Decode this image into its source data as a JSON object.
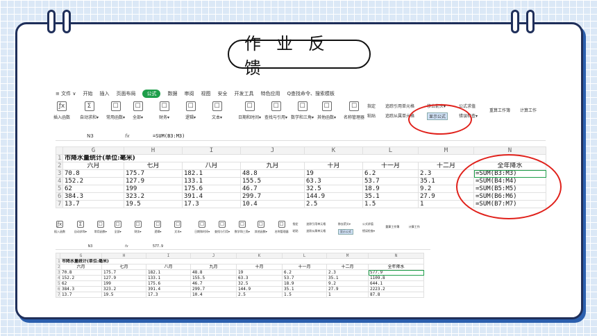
{
  "slide": {
    "title": "作业反馈"
  },
  "menubar": {
    "items": [
      "≡ 文件 ∨",
      "开始",
      "插入",
      "页面布局",
      "公式",
      "数据",
      "审阅",
      "视图",
      "安全",
      "开发工具",
      "特色应用",
      "Q查找命令、搜索模板"
    ],
    "active_index": 4
  },
  "ribbon": {
    "buttons": [
      "插入函数",
      "自动求和▾",
      "常用函数▾",
      "全部▾",
      "财务▾",
      "逻辑▾",
      "文本▾",
      "日期和时间▾",
      "查找与引用▾",
      "数学和三角▾",
      "其他函数▾",
      "名称管理器"
    ],
    "small_items": [
      "指定",
      "粘贴",
      "追踪引用单元格",
      "追踪从属单元格",
      "移去箭头▾",
      "显示公式",
      "公式求值",
      "错误检查▾",
      "重算工作簿",
      "计算工作"
    ]
  },
  "formula_bar": {
    "cell_ref": "N3",
    "fx": "fx",
    "formula": "=SUM(B3:M3)"
  },
  "sheet": {
    "col_headers": [
      "",
      "G",
      "H",
      "I",
      "J",
      "K",
      "L",
      "M",
      "N"
    ],
    "title": "市降水量统计(单位:毫米)",
    "months": [
      "六月",
      "七月",
      "八月",
      "九月",
      "十月",
      "十一月",
      "十二月",
      "全年降水"
    ],
    "rows": [
      {
        "n": "3",
        "cells": [
          "70.8",
          "175.7",
          "182.1",
          "48.8",
          "19",
          "6.2",
          "2.3",
          "=SUM(B3:M3)"
        ]
      },
      {
        "n": "4",
        "cells": [
          "152.2",
          "127.9",
          "133.1",
          "155.5",
          "63.3",
          "53.7",
          "35.1",
          "=SUM(B4:M4)"
        ]
      },
      {
        "n": "5",
        "cells": [
          "62",
          "199",
          "175.6",
          "46.7",
          "32.5",
          "18.9",
          "9.2",
          "=SUM(B5:M5)"
        ]
      },
      {
        "n": "6",
        "cells": [
          "384.3",
          "323.2",
          "391.4",
          "299.7",
          "144.9",
          "35.1",
          "27.9",
          "=SUM(B6:M6)"
        ]
      },
      {
        "n": "7",
        "cells": [
          "13.7",
          "19.5",
          "17.3",
          "10.4",
          "2.5",
          "1.5",
          "1",
          "=SUM(B7:M7)"
        ]
      }
    ]
  },
  "formula_bar2": {
    "cell_ref": "N3",
    "fx": "fx",
    "value": "577.9"
  },
  "sheet2": {
    "rows": [
      {
        "n": "3",
        "cells": [
          "70.8",
          "175.7",
          "182.1",
          "48.8",
          "19",
          "6.2",
          "2.3",
          "577.9"
        ]
      },
      {
        "n": "4",
        "cells": [
          "152.2",
          "127.9",
          "133.1",
          "155.5",
          "63.3",
          "53.7",
          "35.1",
          "1109.8"
        ]
      },
      {
        "n": "5",
        "cells": [
          "62",
          "199",
          "175.6",
          "46.7",
          "32.5",
          "18.9",
          "9.2",
          "644.1"
        ]
      },
      {
        "n": "6",
        "cells": [
          "384.3",
          "323.2",
          "391.4",
          "299.7",
          "144.9",
          "35.1",
          "27.9",
          "2223.2"
        ]
      },
      {
        "n": "7",
        "cells": [
          "13.7",
          "19.5",
          "17.3",
          "10.4",
          "2.5",
          "1.5",
          "1",
          "87.8"
        ]
      }
    ]
  },
  "colors": {
    "accent_green": "#1e9e4a",
    "annotation_red": "#e0201a",
    "frame": "#1f2f5a"
  }
}
